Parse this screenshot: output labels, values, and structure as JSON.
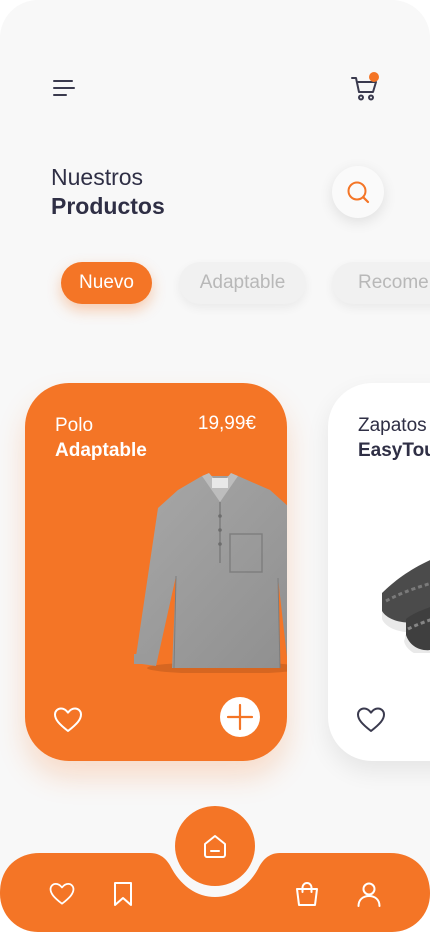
{
  "theme": {
    "accent": "#f47526",
    "text_dark": "#2f2f45",
    "muted": "#b8b8b8"
  },
  "header": {
    "menu_icon": "hamburger-menu-icon",
    "cart_icon": "cart-icon",
    "cart_has_notification": true
  },
  "title": {
    "line1": "Nuestros",
    "line2": "Productos"
  },
  "search": {
    "icon": "search-icon"
  },
  "tabs": [
    {
      "label": "Nuevo",
      "active": true
    },
    {
      "label": "Adaptable",
      "active": false
    },
    {
      "label": "Recome",
      "active": false
    }
  ],
  "products": [
    {
      "name_line1": "Polo",
      "name_line2": "Adaptable",
      "price": "19,99€",
      "image": "grey-polo-shirt",
      "fav_icon": "heart-icon",
      "add_icon": "plus-icon"
    },
    {
      "name_line1": "Zapatos",
      "name_line2": "EasyTou",
      "image": "grey-knit-sneakers",
      "fav_icon": "heart-icon"
    }
  ],
  "bottom_nav": {
    "items": [
      "heart-icon",
      "bookmark-icon",
      "home-icon",
      "shopping-bag-icon",
      "user-icon"
    ],
    "active": "home-icon"
  }
}
